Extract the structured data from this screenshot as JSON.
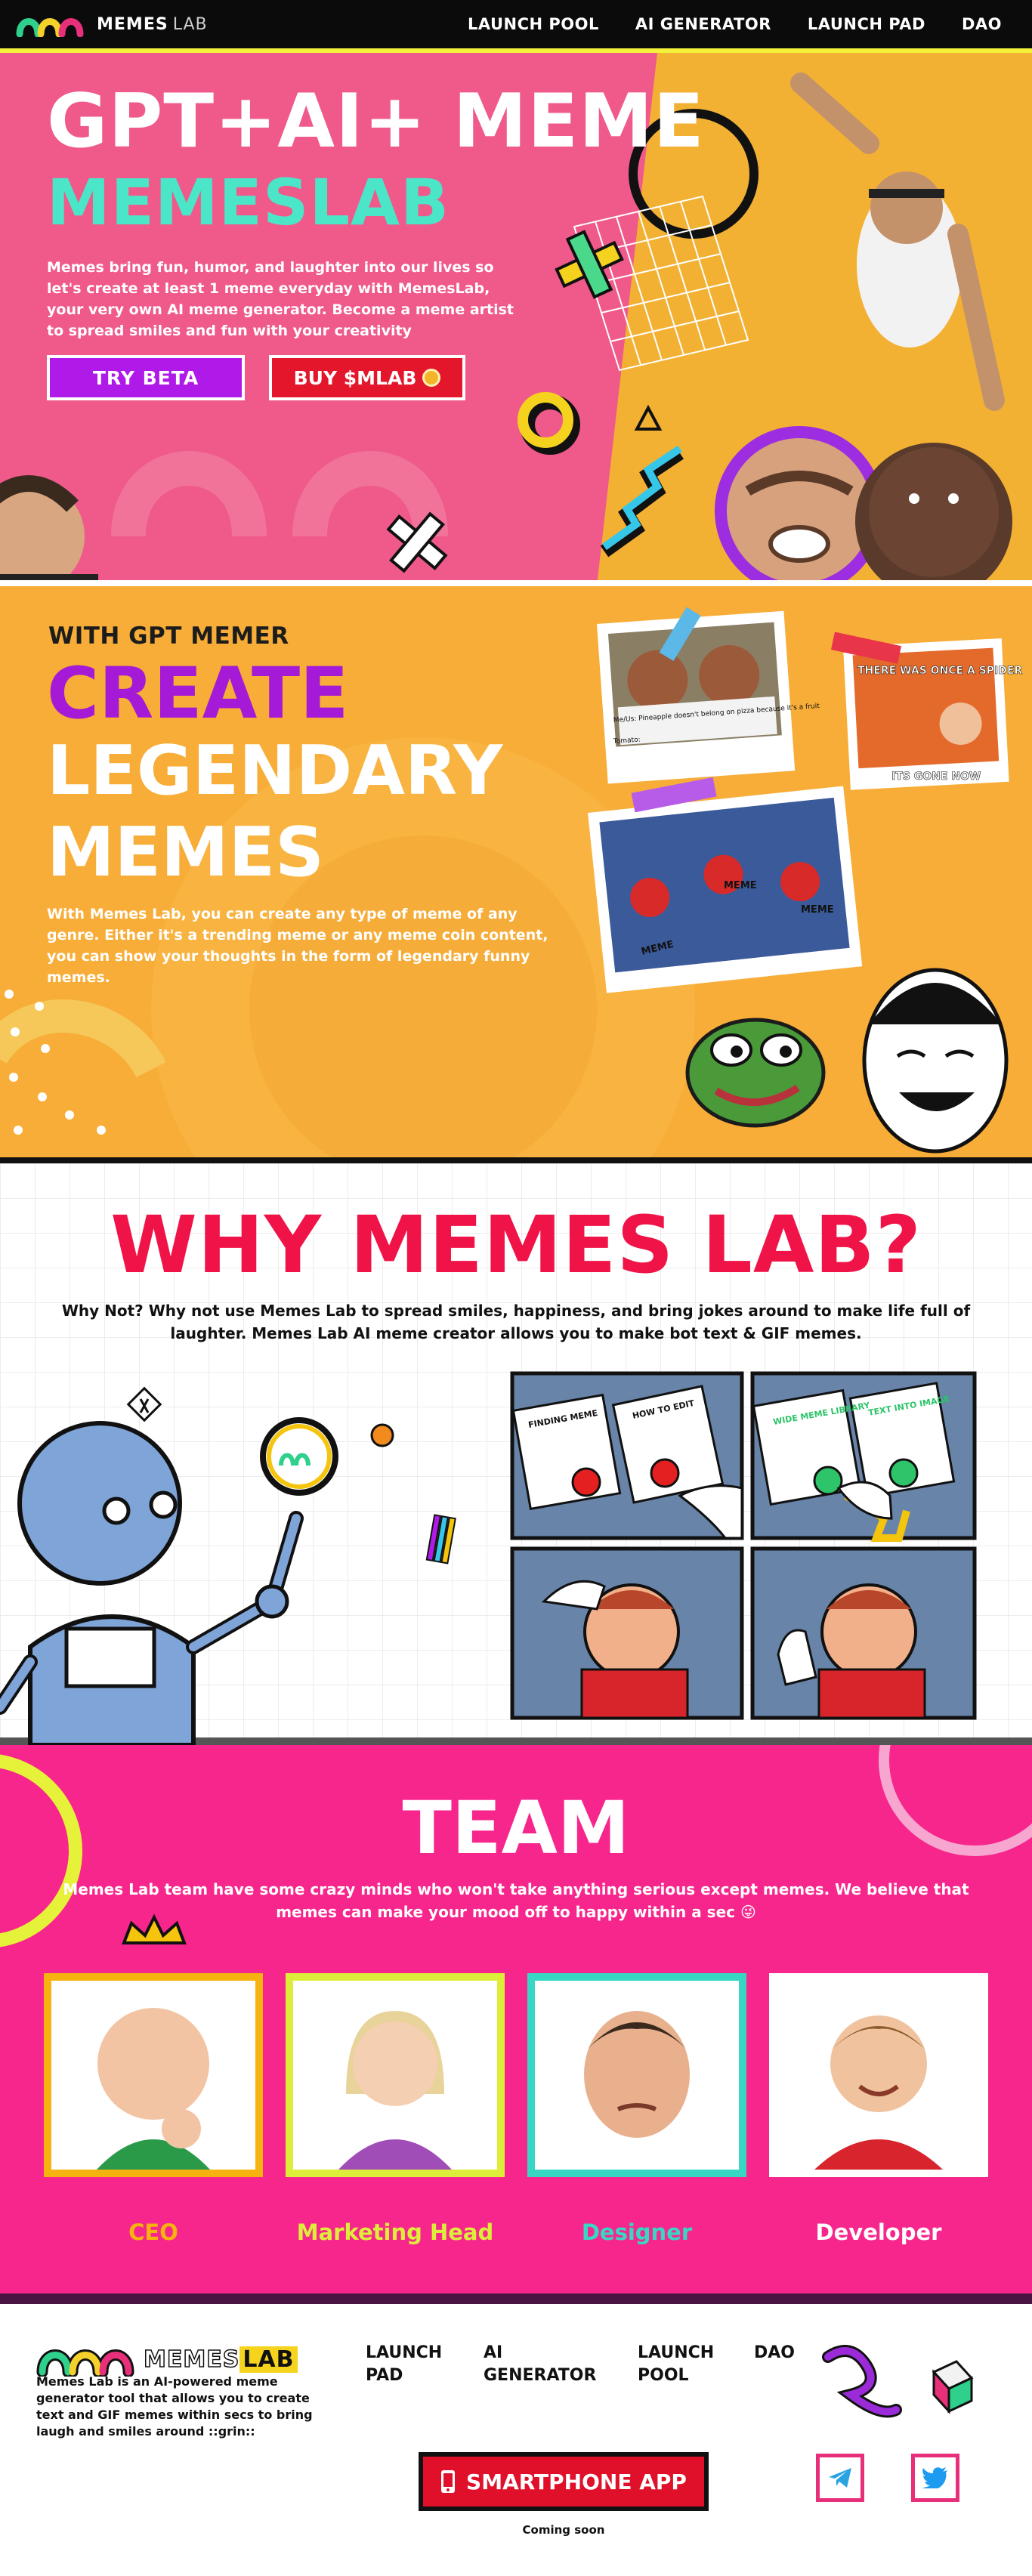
{
  "nav": {
    "brand_main": "MEMES",
    "brand_lab": "LAB",
    "links": [
      "LAUNCH POOL",
      "AI GENERATOR",
      "LAUNCH PAD",
      "DAO"
    ]
  },
  "hero": {
    "title": "GPT+AI+ MEME",
    "subtitle": "MEMESLAB",
    "description": "Memes bring fun, humor, and laughter into our lives so let's create at least 1 meme everyday with MemesLab, your very own AI meme generator. Become a meme artist to spread smiles and fun with your creativity",
    "try_beta": "TRY BETA",
    "buy": "BUY $MLAB"
  },
  "create": {
    "eyebrow": "WITH GPT MEMER",
    "line1": "CREATE",
    "line2": "LEGENDARY",
    "line3": "MEMES",
    "description": "With Memes Lab, you can create any type of meme of any genre. Either it's a trending meme or any meme coin content, you can show your thoughts in the form of legendary funny memes.",
    "captions": {
      "spider_top": "THERE WAS ONCE A SPIDER",
      "spider_bottom": "ITS GONE NOW",
      "meme1": "MEME",
      "meme2": "MEME",
      "meme3": "MEME",
      "puppet_text": "Me/Us: Pineapple doesn't belong on pizza because it's a fruit",
      "puppet_sub": "Tomato:"
    }
  },
  "why": {
    "title": "WHY MEMES LAB?",
    "description": "Why Not? Why not use Memes Lab to spread smiles, happiness, and bring jokes around to make life full of laughter. Memes Lab AI meme creator allows you to make bot text & GIF memes.",
    "comic": {
      "label1": "FINDING MEME",
      "label2": "HOW TO EDIT",
      "label3": "WIDE MEME LIBRARY",
      "label4": "TEXT INTO IMAGE"
    }
  },
  "team": {
    "title": "TEAM",
    "description": "Memes Lab team have some crazy minds who won't take anything serious except memes. We believe that memes can make your mood off to happy within a sec 😜",
    "members": [
      {
        "role": "CEO",
        "color": "#f6b30f"
      },
      {
        "role": "Marketing Head",
        "color": "#ddee3a"
      },
      {
        "role": "Designer",
        "color": "#37d7c4"
      },
      {
        "role": "Developer",
        "color": "#ffffff"
      }
    ]
  },
  "footer": {
    "brand_main": "MEMES",
    "brand_lab": "LAB",
    "description": "Memes Lab is an AI-powered meme generator tool that allows you to create text and GIF memes within secs to bring laugh and smiles around ::grin::",
    "links": [
      "LAUNCH PAD",
      "AI GENERATOR",
      "LAUNCH POOL",
      "DAO"
    ],
    "app_button": "SMARTPHONE APP",
    "coming_soon": "Coming soon"
  },
  "colors": {
    "nav_bg": "#0b0b0b",
    "nav_border": "#f4f13a",
    "hero_pink": "#ef5a8b",
    "hero_orange": "#f3b134",
    "mint": "#4be6c8",
    "purple": "#a41ad6",
    "red": "#f01347",
    "team_pink": "#f7268c"
  },
  "icons": [
    "logo-icon",
    "coin-icon",
    "telegram-icon",
    "twitter-icon",
    "phone-icon",
    "crown-icon",
    "robot-icon"
  ]
}
